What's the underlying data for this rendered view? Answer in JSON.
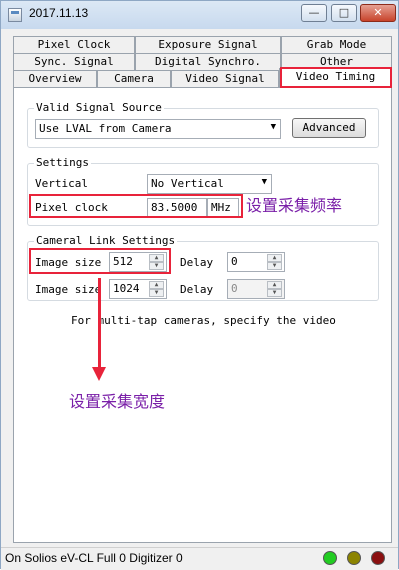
{
  "window": {
    "title": "2017.11.13",
    "min_glyph": "—",
    "max_glyph": "□",
    "close_glyph": "✕"
  },
  "tabs_row1": [
    {
      "label": "Pixel Clock"
    },
    {
      "label": "Exposure Signal"
    },
    {
      "label": "Grab Mode"
    }
  ],
  "tabs_row2": [
    {
      "label": "Sync. Signal"
    },
    {
      "label": "Digital Synchro."
    },
    {
      "label": "Other"
    }
  ],
  "tabs_row3": [
    {
      "label": "Overview"
    },
    {
      "label": "Camera"
    },
    {
      "label": "Video Signal"
    },
    {
      "label": "Video Timing",
      "active": true
    }
  ],
  "valid_signal": {
    "group_label": "Valid Signal Source",
    "selected": "Use LVAL from Camera",
    "advanced_label": "Advanced"
  },
  "settings": {
    "group_label": "Settings",
    "vertical_label": "Vertical",
    "vertical_selected": "No Vertical",
    "pixel_clock_label": "Pixel clock",
    "pixel_clock_value": "83.5000",
    "pixel_clock_unit": "MHz"
  },
  "camera_link": {
    "group_label": "Cameral Link Settings",
    "rows": [
      {
        "label": "Image size",
        "value": "512",
        "delay_label": "Delay",
        "delay_value": "0"
      },
      {
        "label": "Image size",
        "value": "1024",
        "delay_label": "Delay",
        "delay_value": "0"
      }
    ]
  },
  "multi_tap_note": "For multi-tap cameras, specify the video",
  "annotations": {
    "pixel_clock_note": "设置采集频率",
    "image_size_note": "设置采集宽度",
    "highlight_color": "#e8233a",
    "note_color": "#7a1fa8"
  },
  "status_bar": {
    "text": "On Solios eV-CL Full 0 Digitizer 0",
    "leds": [
      {
        "name": "green",
        "color": "#22cc22"
      },
      {
        "name": "olive",
        "color": "#8c8400"
      },
      {
        "name": "dark-red",
        "color": "#8a0f10"
      }
    ]
  }
}
